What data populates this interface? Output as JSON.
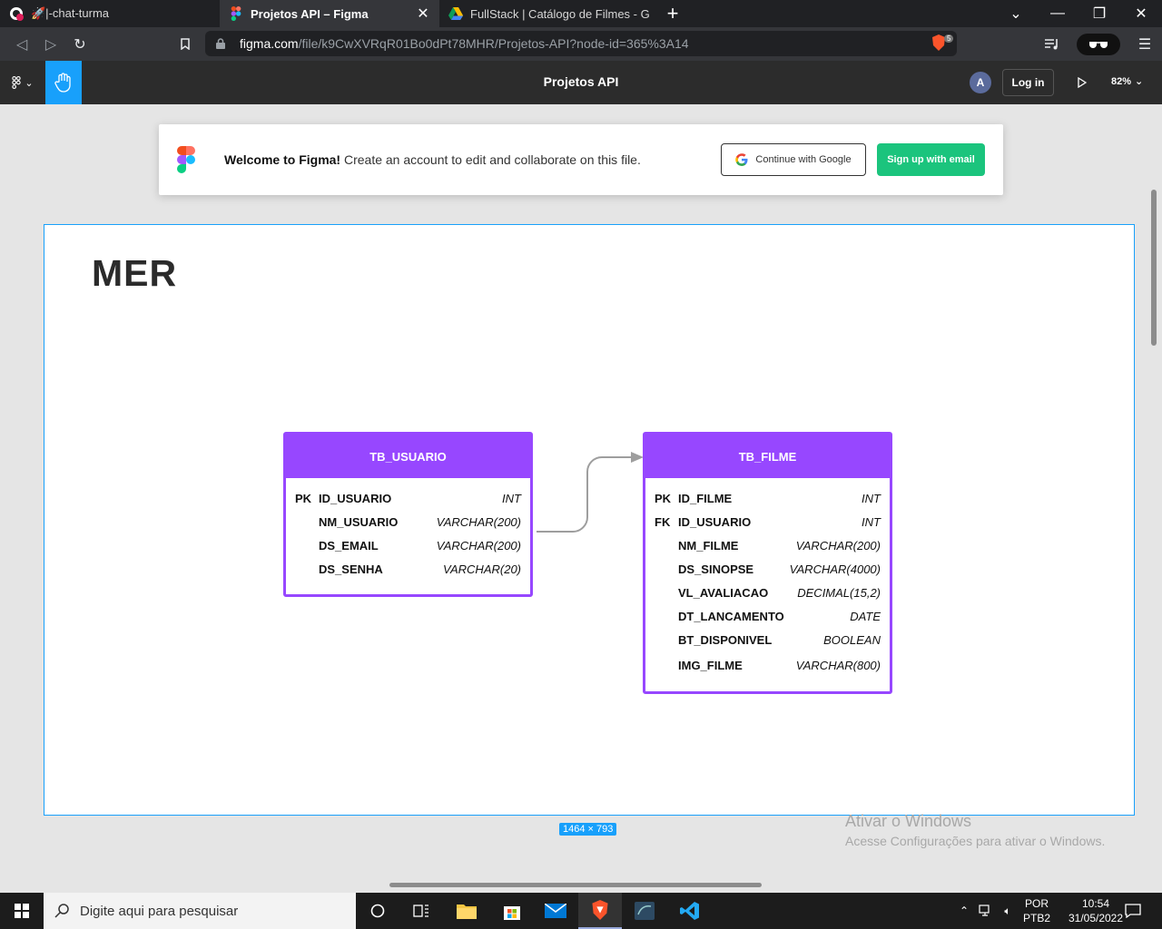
{
  "browser": {
    "tabs": [
      {
        "title": "🚀|-chat-turma",
        "favicon": "github-icon",
        "badge": "3",
        "active": false
      },
      {
        "title": "Projetos API – Figma",
        "favicon": "figma-icon",
        "active": true
      },
      {
        "title": "FullStack | Catálogo de Filmes - Googl",
        "favicon": "google-drive-icon",
        "active": false
      }
    ],
    "url": {
      "host": "figma.com",
      "path": "/file/k9CwXVRqR01Bo0dPt78MHR/Projetos-API?node-id=365%3A14"
    },
    "shield_count": "5"
  },
  "figma": {
    "file_title": "Projetos API",
    "avatar_initial": "A",
    "login_label": "Log in",
    "zoom": "82%",
    "accent_color": "#18a0fb"
  },
  "banner": {
    "bold": "Welcome to Figma!",
    "text": " Create an account to edit and collaborate on this file.",
    "google_label": "Continue with Google",
    "email_label": "Sign up with email"
  },
  "diagram": {
    "title": "MER",
    "table_color": "#9747ff",
    "tables": [
      {
        "name": "TB_USUARIO",
        "columns": [
          {
            "key": "PK",
            "name": "ID_USUARIO",
            "type": "INT"
          },
          {
            "key": "",
            "name": "NM_USUARIO",
            "type": "VARCHAR(200)"
          },
          {
            "key": "",
            "name": "DS_EMAIL",
            "type": "VARCHAR(200)"
          },
          {
            "key": "",
            "name": "DS_SENHA",
            "type": "VARCHAR(20)"
          }
        ]
      },
      {
        "name": "TB_FILME",
        "columns": [
          {
            "key": "PK",
            "name": "ID_FILME",
            "type": "INT"
          },
          {
            "key": "FK",
            "name": "ID_USUARIO",
            "type": "INT"
          },
          {
            "key": "",
            "name": "NM_FILME",
            "type": "VARCHAR(200)"
          },
          {
            "key": "",
            "name": "DS_SINOPSE",
            "type": "VARCHAR(4000)"
          },
          {
            "key": "",
            "name": "VL_AVALIACAO",
            "type": "DECIMAL(15,2)"
          },
          {
            "key": "",
            "name": "DT_LANCAMENTO",
            "type": "DATE"
          },
          {
            "key": "",
            "name": "BT_DISPONIVEL",
            "type": "BOOLEAN"
          },
          {
            "key": "",
            "name": "IMG_FILME",
            "type": "VARCHAR(800)"
          }
        ]
      }
    ]
  },
  "frame_size_label": "1464 × 793",
  "windows_activation": {
    "title": "Ativar o Windows",
    "subtitle": "Acesse Configurações para ativar o Windows."
  },
  "taskbar": {
    "search_placeholder": "Digite aqui para pesquisar",
    "lang_line1": "POR",
    "lang_line2": "PTB2",
    "time": "10:54",
    "date": "31/05/2022"
  }
}
